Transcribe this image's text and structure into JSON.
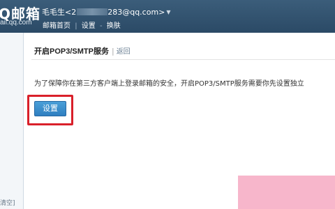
{
  "header": {
    "logo_text": "Q邮箱",
    "logo_domain": "ail.qq.com",
    "user_name_prefix": "毛毛生<2",
    "user_email_suffix": "283@qq.com>",
    "user_caret": "▼",
    "nav": {
      "home": "邮箱首页",
      "separator": "|",
      "settings": "设置",
      "dash": "-",
      "skin": "换肤"
    }
  },
  "sidebar": {
    "clear_label": "清空]"
  },
  "main": {
    "title": "开启POP3/SMTP服务",
    "title_separator": "|",
    "back_label": "返回",
    "description": "为了保障你在第三方客户端上登录邮箱的安全，开启POP3/SMTP服务需要你先设置独立",
    "settings_button": "设置"
  },
  "colors": {
    "header_bg": "#2b4a66",
    "button_bg": "#2f7fc0",
    "highlight": "#d9202a",
    "watermark": "#f7b6cb"
  }
}
